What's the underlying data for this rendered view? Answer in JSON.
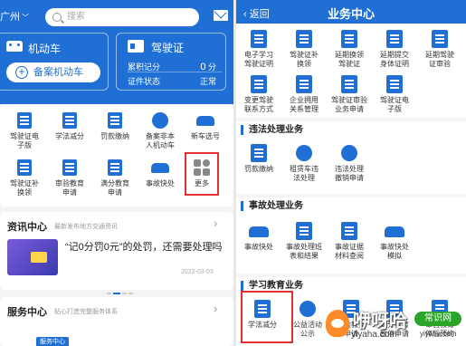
{
  "left": {
    "city": "广州",
    "search_placeholder": "搜索",
    "car_card": {
      "title": "机动车",
      "add_button": "备案机动车"
    },
    "license_card": {
      "title": "驾驶证",
      "points_label": "累积记分",
      "points_value": "0",
      "points_unit": "分",
      "status_label": "证件状态",
      "status_value": "正常"
    },
    "grid": [
      {
        "label": "驾驶证电\n子版",
        "icon": "doc-icon"
      },
      {
        "label": "学法减分",
        "icon": "book-icon"
      },
      {
        "label": "罚款缴纳",
        "icon": "yen-icon"
      },
      {
        "label": "备案非本\n人机动车",
        "icon": "badge-icon"
      },
      {
        "label": "新车选号",
        "icon": "car-icon"
      },
      {
        "label": "驾驶证补\n换领",
        "icon": "license-icon"
      },
      {
        "label": "审验教育\n申请",
        "icon": "review-icon"
      },
      {
        "label": "满分教育\n申请",
        "icon": "full-score-icon"
      },
      {
        "label": "事故快处",
        "icon": "accident-icon"
      },
      {
        "label": "更多",
        "icon": "more-icon"
      }
    ],
    "news": {
      "title": "资讯中心",
      "subtitle": "最新发布地方交通资讯",
      "headline": "“记0分罚0元”的处罚，还需要处理吗",
      "date": "2022-03-03"
    },
    "service": {
      "title": "服务中心",
      "subtitle": "贴心打造完整服务体系",
      "tag": "服务中心"
    }
  },
  "right": {
    "back": "返回",
    "title": "业务中心",
    "top_items": [
      {
        "label": "电子学习\n驾驶证明"
      },
      {
        "label": "驾驶证补\n换领"
      },
      {
        "label": "延期换领\n驾驶证"
      },
      {
        "label": "延期提交\n身体证明"
      },
      {
        "label": "延期驾驶\n证审验"
      },
      {
        "label": "变更驾驶\n联系方式"
      },
      {
        "label": "企业拥用\n关系管理"
      },
      {
        "label": "驾驶证审验\n业务申请"
      },
      {
        "label": "驾驶证电\n子版"
      }
    ],
    "violation": {
      "title": "违法处理业务",
      "items": [
        {
          "label": "罚款缴纳"
        },
        {
          "label": "租赁车违\n法处理"
        },
        {
          "label": "违法处理\n撤销申请"
        }
      ]
    },
    "accident": {
      "title": "事故处理业务",
      "items": [
        {
          "label": "事故快处"
        },
        {
          "label": "事故处理班\n表和结果"
        },
        {
          "label": "事故证据\n材料查阅"
        },
        {
          "label": "事故快处\n模拟"
        }
      ]
    },
    "education": {
      "title": "学习教育业务",
      "items": [
        {
          "label": "学法减分"
        },
        {
          "label": "公益活动\n公示"
        },
        {
          "label": "审验教育\n申请"
        },
        {
          "label": "满分教育\n暂停申请"
        },
        {
          "label": "审验教育\n停后预约"
        }
      ]
    }
  },
  "watermark": {
    "text": "咿呀哈",
    "url": "yiyaha.com",
    "badge": "常识网",
    "url2": "yiyaha.com"
  },
  "colors": {
    "brand": "#1f6fd4",
    "highlight": "#e03030"
  }
}
